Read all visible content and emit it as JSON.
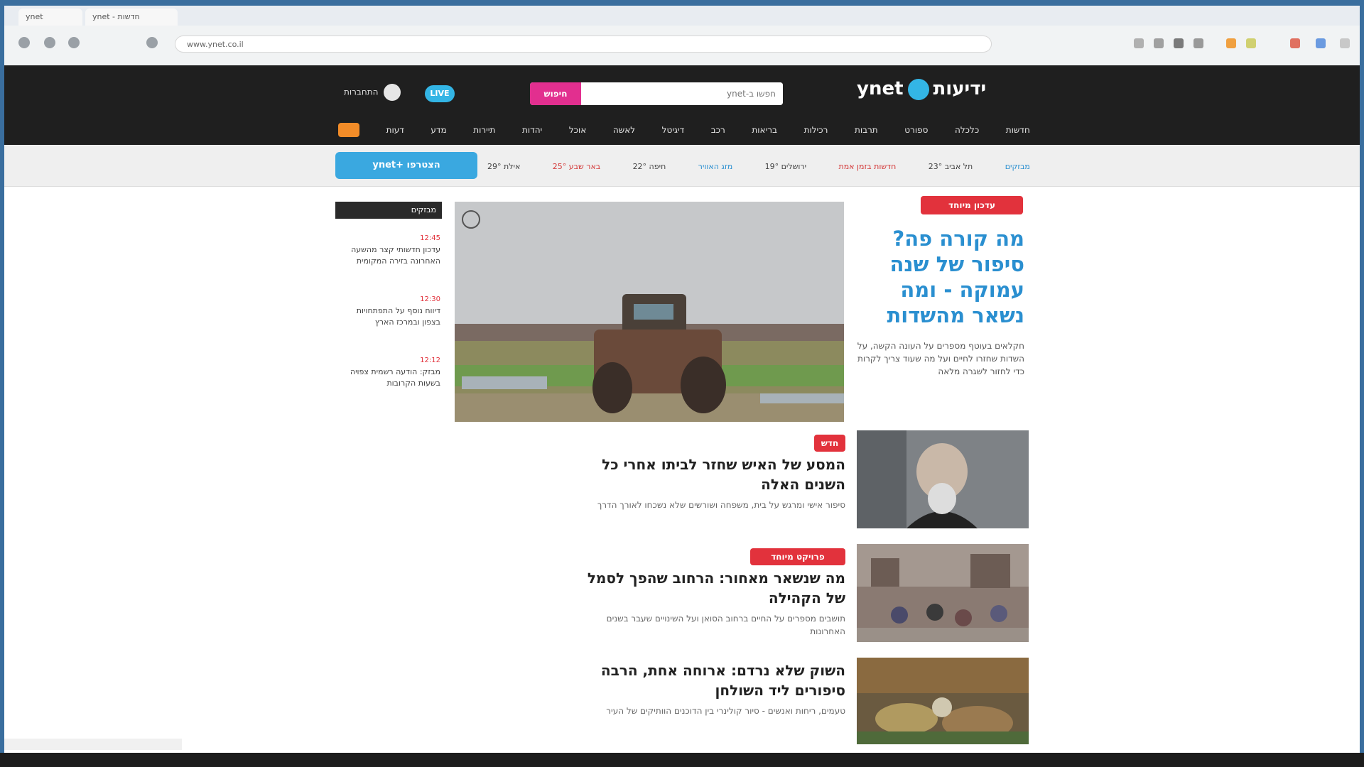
{
  "browser": {
    "tabs": [
      "ynet",
      "ynet - חדשות"
    ],
    "url": "www.ynet.co.il"
  },
  "header": {
    "logo_text": "ynet",
    "logo_sub": "ידיעות",
    "search_button": "חיפוש",
    "search_placeholder": "חפשו ב-ynet",
    "live_label": "LIVE",
    "user_label": "התחברות"
  },
  "nav": [
    "חדשות",
    "כלכלה",
    "ספורט",
    "תרבות",
    "רכילות",
    "בריאות",
    "רכב",
    "דיגיטל",
    "לאשה",
    "אוכל",
    "יהדות",
    "תיירות",
    "מדע",
    "דעות"
  ],
  "ticker": {
    "promo_label": "ynet+ הצטרפו",
    "items": [
      {
        "text": "מבזקים",
        "style": "blue"
      },
      {
        "text": "תל אביב 23°",
        "style": ""
      },
      {
        "text": "חדשות בזמן אמת",
        "style": "red"
      },
      {
        "text": "ירושלים 19°",
        "style": ""
      },
      {
        "text": "מזג האוויר",
        "style": "blue"
      },
      {
        "text": "חיפה 22°",
        "style": ""
      },
      {
        "text": "באר שבע 25°",
        "style": "red"
      },
      {
        "text": "אילת 29°",
        "style": ""
      }
    ]
  },
  "lead": {
    "tag": "עדכון מיוחד",
    "title": "מה קורה פה? סיפור של שנה עמוקה - ומה נשאר מהשדות",
    "summary": "חקלאים בעוטף מספרים על העונה הקשה, על השדות שחזרו לחיים ועל מה שעוד צריך לקרות כדי לחזור לשגרה מלאה"
  },
  "side_box": {
    "header": "מבזקים",
    "items": [
      {
        "time": "12:45",
        "text": "עדכון חדשותי קצר מהשעה האחרונה בזירה המקומית"
      },
      {
        "time": "12:30",
        "text": "דיווח נוסף על התפתחויות בצפון ובמרכז הארץ"
      },
      {
        "time": "12:12",
        "text": "מבזק: הודעה רשמית צפויה בשעות הקרובות"
      }
    ]
  },
  "stories": [
    {
      "tag": "חדש",
      "title": "המסע של האיש שחזר לביתו אחרי כל השנים האלה",
      "summary": "סיפור אישי ומרגש על בית, משפחה ושורשים שלא נשכחו לאורך הדרך"
    },
    {
      "tag": "פרויקט מיוחד",
      "title": "מה שנשאר מאחור: הרחוב שהפך לסמל של הקהילה",
      "summary": "תושבים מספרים על החיים ברחוב הסואן ועל השינויים שעבר בשנים האחרונות"
    },
    {
      "tag": "",
      "title": "השוק שלא נרדם: ארוחה אחת, הרבה סיפורים ליד השולחן",
      "summary": "טעמים, ריחות ואנשים - סיור קולינרי בין הדוכנים הוותיקים של העיר"
    }
  ]
}
